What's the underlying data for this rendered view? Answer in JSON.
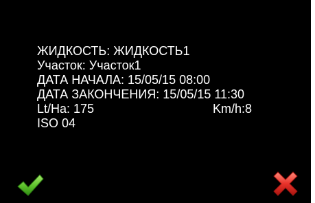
{
  "screen": {
    "background": "#000000",
    "text_color": "#ffffff",
    "lines": {
      "liquid": "ЖИДКОСТЬ:  ЖИДКОСТЬ1",
      "plot": "Участок: Участок1",
      "start_date": "ДАТА НАЧАЛА: 15/05/15 08:00",
      "end_date": "ДАТА ЗАКОНЧЕНИЯ: 15/05/15 11:30",
      "rate": "Lt/Ha: 175",
      "speed": "Km/h:8",
      "iso": "ISO 04"
    }
  },
  "buttons": {
    "confirm": {
      "icon": "checkmark-icon",
      "color": "#5bbf2a"
    },
    "cancel": {
      "icon": "cross-icon",
      "color": "#e8322a"
    }
  }
}
